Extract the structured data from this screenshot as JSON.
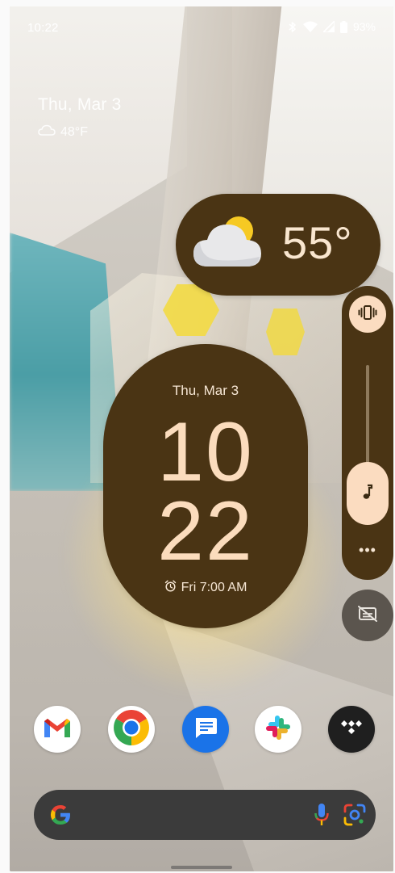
{
  "status_bar": {
    "time": "10:22",
    "battery_percent": "93%",
    "icons": [
      "bluetooth-icon",
      "wifi-icon",
      "signal-icon",
      "battery-icon"
    ]
  },
  "at_a_glance": {
    "date": "Thu, Mar 3",
    "weather": "48°F",
    "weather_icon": "cloud-icon"
  },
  "weather_widget": {
    "temperature": "55°",
    "icon": "partly-cloudy-icon"
  },
  "clock_widget": {
    "date": "Thu, Mar 3",
    "hour": "10",
    "minute": "22",
    "alarm": "Fri 7:00 AM",
    "alarm_icon": "alarm-icon"
  },
  "volume_panel": {
    "ringer_mode_icon": "vibrate-icon",
    "stream_icon": "music-note-icon",
    "more_label": "•••",
    "captions_icon": "live-caption-off-icon"
  },
  "dock": {
    "apps": [
      {
        "name": "Gmail",
        "icon": "gmail-icon"
      },
      {
        "name": "Chrome",
        "icon": "chrome-icon"
      },
      {
        "name": "Messages",
        "icon": "messages-icon"
      },
      {
        "name": "Slack",
        "icon": "slack-icon"
      },
      {
        "name": "TIDAL",
        "icon": "tidal-icon"
      }
    ]
  },
  "search_bar": {
    "logo_icon": "google-g-icon",
    "mic_icon": "mic-icon",
    "lens_icon": "lens-icon"
  },
  "colors": {
    "widget_bg": "#4a3414",
    "widget_text": "#fbdcbd",
    "accent": "#fbdcc0",
    "search_bg": "#3b3b3b"
  }
}
